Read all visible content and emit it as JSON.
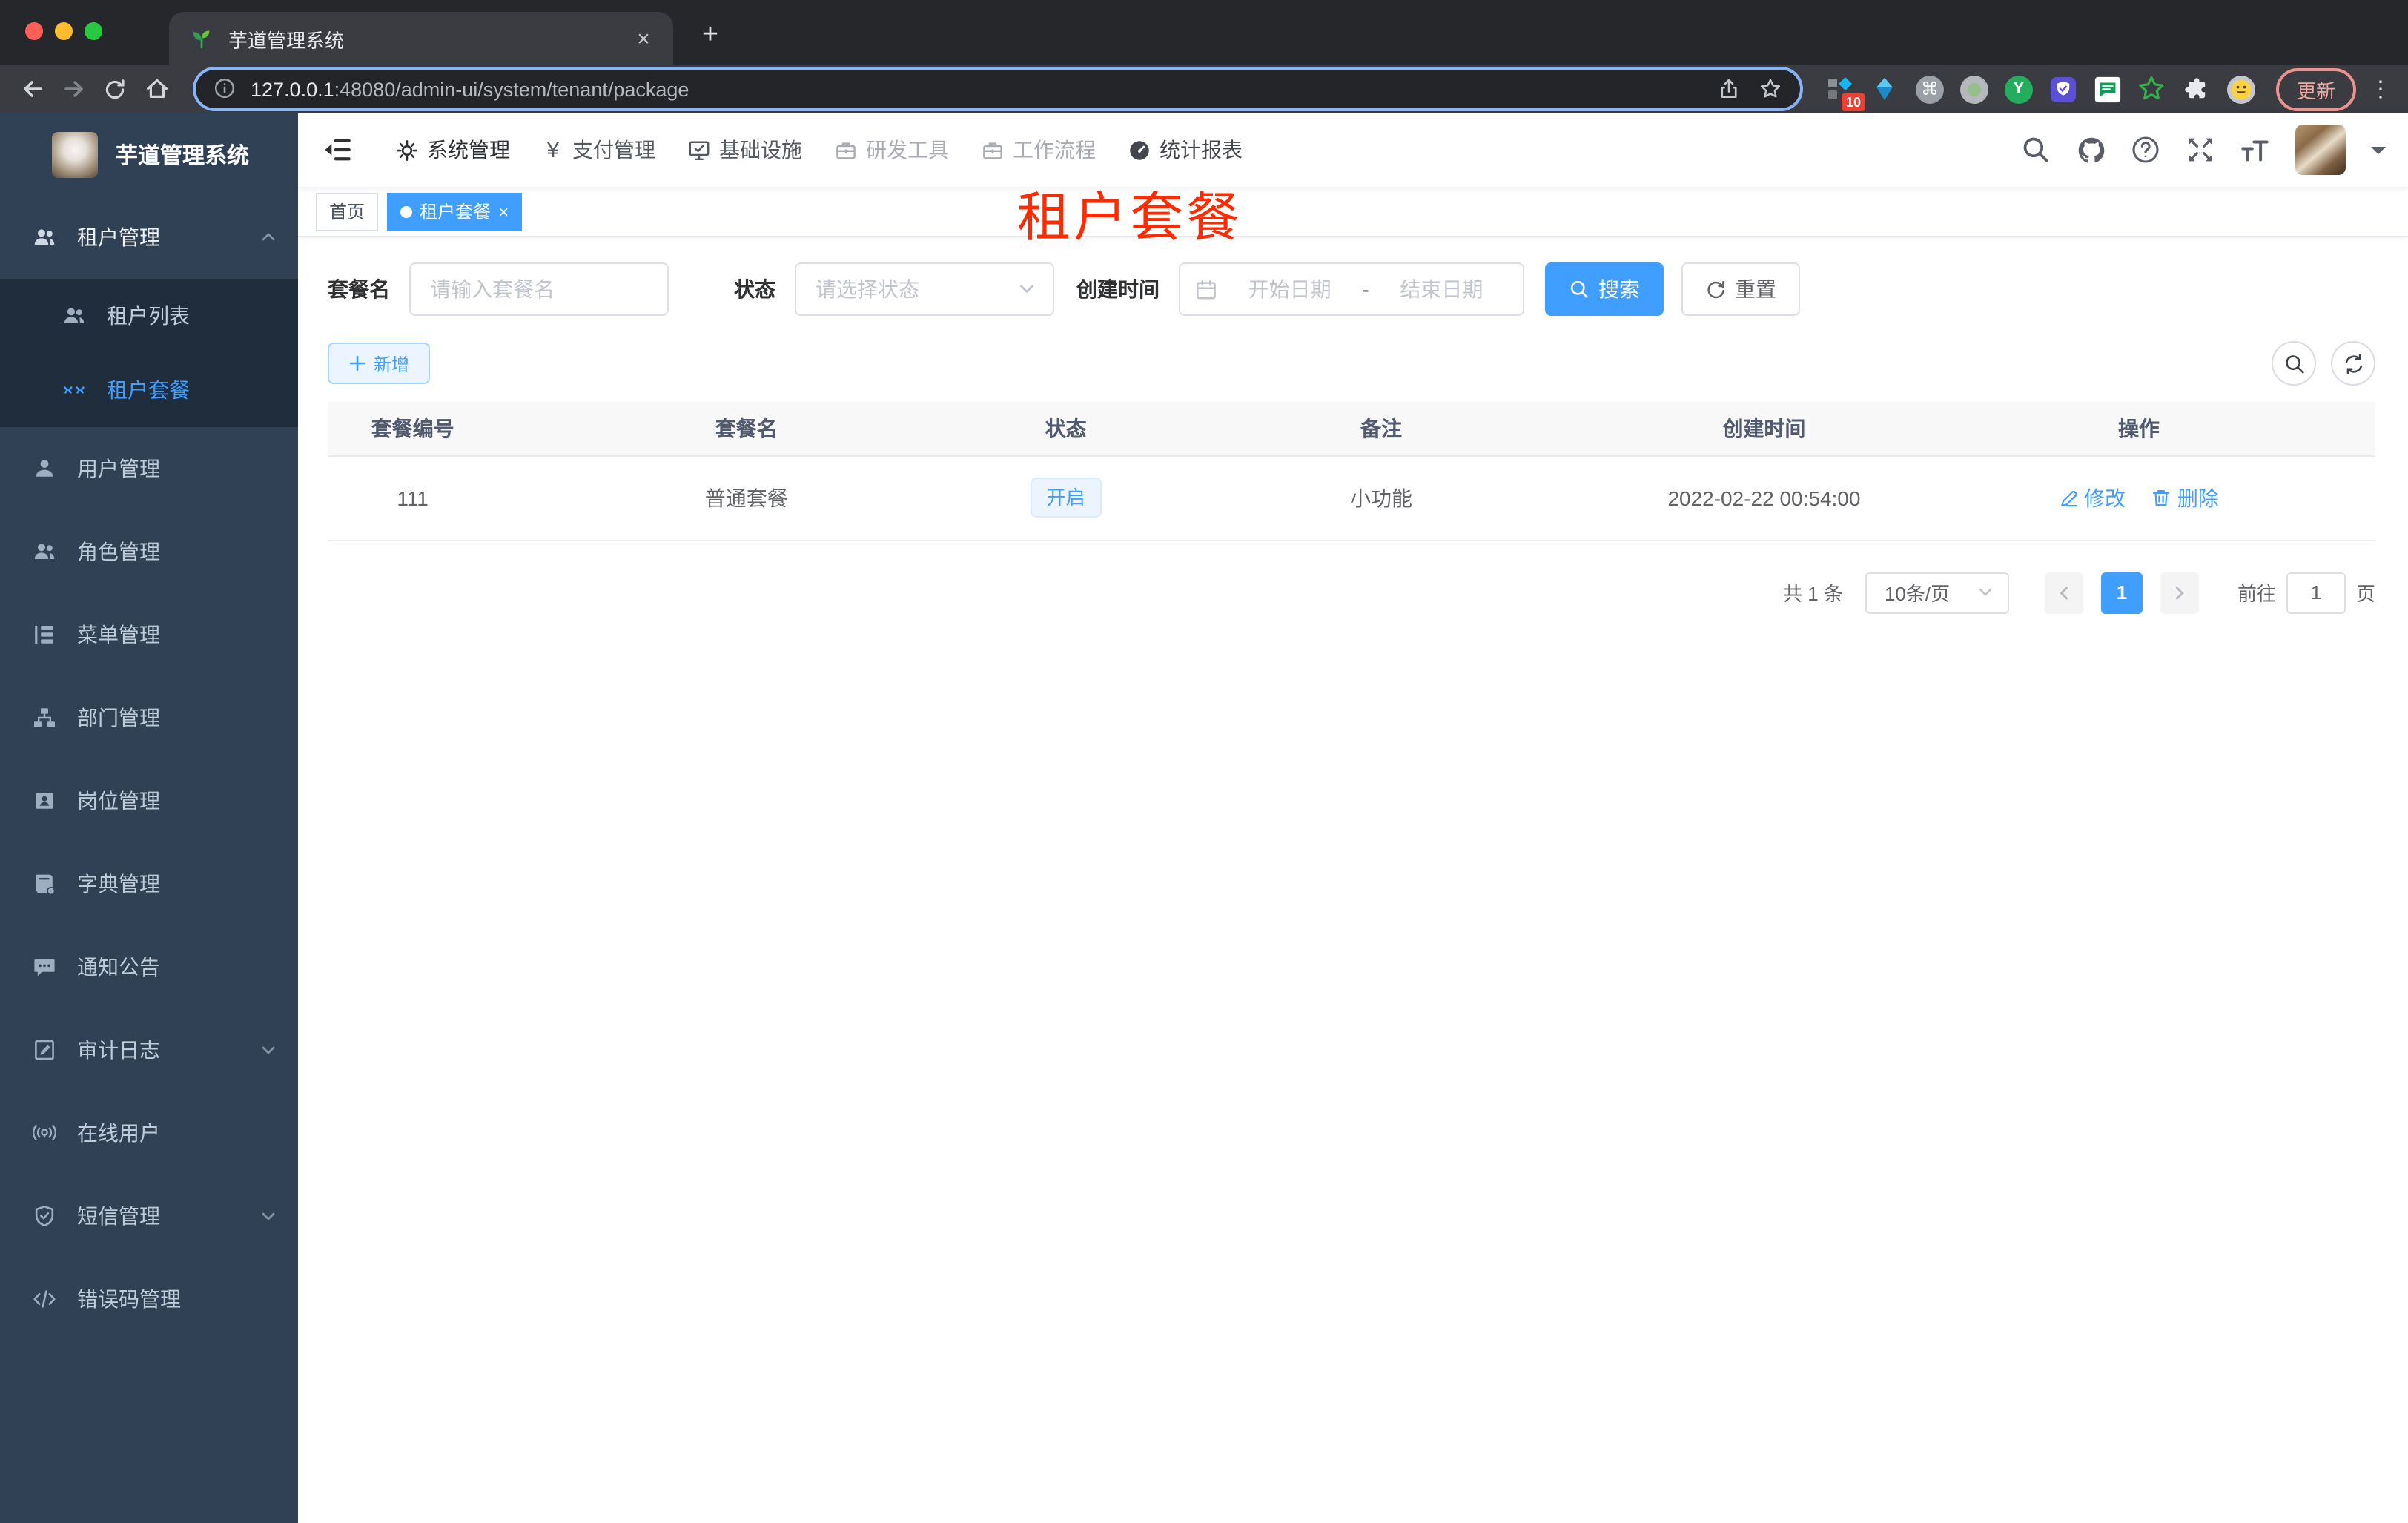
{
  "browser": {
    "tab_title": "芋道管理系统",
    "url_host": "127.0.0.1",
    "url_path": ":48080/admin-ui/system/tenant/package",
    "extension_badge": "10",
    "update_label": "更新"
  },
  "glyphs": {
    "close": "×",
    "new_tab": "+",
    "kebab": "⋮",
    "yen": "¥",
    "command": "⌘",
    "letter_y": "Y"
  },
  "sidebar": {
    "title": "芋道管理系统",
    "items": [
      {
        "label": "租户管理"
      },
      {
        "label": "租户列表"
      },
      {
        "label": "租户套餐"
      },
      {
        "label": "用户管理"
      },
      {
        "label": "角色管理"
      },
      {
        "label": "菜单管理"
      },
      {
        "label": "部门管理"
      },
      {
        "label": "岗位管理"
      },
      {
        "label": "字典管理"
      },
      {
        "label": "通知公告"
      },
      {
        "label": "审计日志"
      },
      {
        "label": "在线用户"
      },
      {
        "label": "短信管理"
      },
      {
        "label": "错误码管理"
      }
    ]
  },
  "topnav": {
    "items": [
      {
        "label": "系统管理"
      },
      {
        "label": "支付管理"
      },
      {
        "label": "基础设施"
      },
      {
        "label": "研发工具"
      },
      {
        "label": "工作流程"
      },
      {
        "label": "统计报表"
      }
    ]
  },
  "tags": {
    "home": "首页",
    "active": "租户套餐"
  },
  "overlay_title": "租户套餐",
  "filters": {
    "name_label": "套餐名",
    "name_placeholder": "请输入套餐名",
    "status_label": "状态",
    "status_placeholder": "请选择状态",
    "date_label": "创建时间",
    "date_start": "开始日期",
    "date_separator": "-",
    "date_end": "结束日期",
    "search": "搜索",
    "reset": "重置"
  },
  "toolbar": {
    "add": "新增"
  },
  "table": {
    "headers": [
      "套餐编号",
      "套餐名",
      "状态",
      "备注",
      "创建时间",
      "操作"
    ],
    "rows": [
      {
        "id": "111",
        "name": "普通套餐",
        "status": "开启",
        "remark": "小功能",
        "created": "2022-02-22 00:54:00",
        "edit": "修改",
        "delete": "删除"
      }
    ]
  },
  "pagination": {
    "total": "共 1 条",
    "page_size": "10条/页",
    "page": "1",
    "goto_label": "前往",
    "goto_value": "1",
    "unit": "页"
  },
  "colors": {
    "accent": "#409eff",
    "overlay_red": "#ff2a00",
    "sidebar_bg": "#304156",
    "submenu_bg": "#1f2d3d",
    "traffic_red": "#ff5f57",
    "traffic_yellow": "#febc2e",
    "traffic_green": "#28c840"
  }
}
